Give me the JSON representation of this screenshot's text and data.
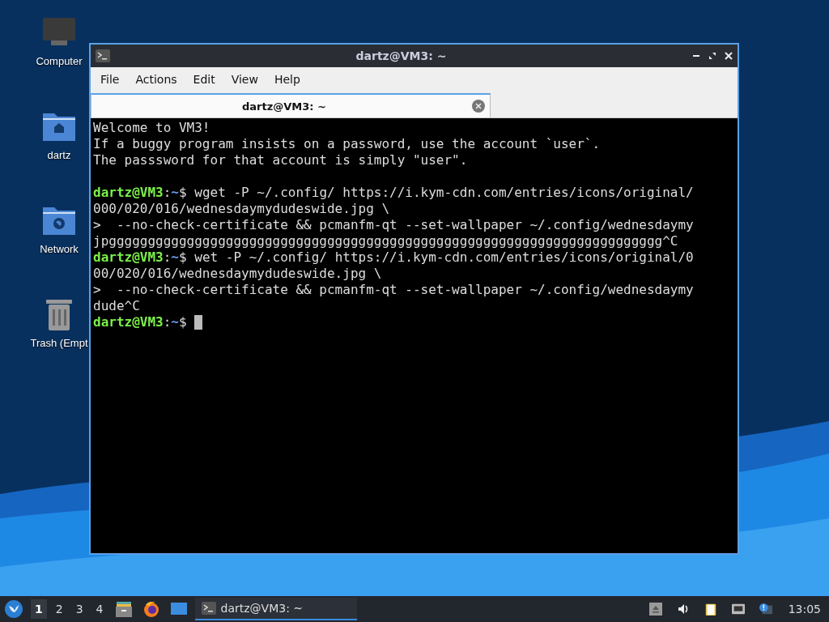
{
  "desktop_icons": [
    {
      "kind": "computer",
      "label": "Computer"
    },
    {
      "kind": "home",
      "label": "dartz"
    },
    {
      "kind": "network",
      "label": "Network"
    },
    {
      "kind": "trash",
      "label": "Trash (Empt"
    }
  ],
  "window": {
    "title": "dartz@VM3: ~",
    "menu": [
      "File",
      "Actions",
      "Edit",
      "View",
      "Help"
    ],
    "tabs": [
      {
        "label": "dartz@VM3: ~",
        "selected": true
      }
    ],
    "terminal": [
      {
        "kind": "text",
        "text": "Welcome to VM3!"
      },
      {
        "kind": "text",
        "text": "If a buggy program insists on a password, use the account `user`."
      },
      {
        "kind": "text",
        "text": "The passsword for that account is simply \"user\"."
      },
      {
        "kind": "blank"
      },
      {
        "kind": "prompt",
        "user": "dartz@VM3",
        "separator": ":",
        "path": "~",
        "command": "$ wget -P ~/.config/ https://i.kym-cdn.com/entries/icons/original/",
        "cursor": false
      },
      {
        "kind": "text",
        "text": "000/020/016/wednesdaymydudeswide.jpg \\"
      },
      {
        "kind": "text",
        "text": ">  --no-check-certificate && pcmanfm-qt --set-wallpaper ~/.config/wednesdaymy"
      },
      {
        "kind": "text",
        "text": "jpggggggggggggggggggggggggggggggggggggggggggggggggggggggggggggggggggggggg^C"
      },
      {
        "kind": "prompt",
        "user": "dartz@VM3",
        "separator": ":",
        "path": "~",
        "command": "$ wet -P ~/.config/ https://i.kym-cdn.com/entries/icons/original/0",
        "cursor": false
      },
      {
        "kind": "text",
        "text": "00/020/016/wednesdaymydudeswide.jpg \\"
      },
      {
        "kind": "text",
        "text": ">  --no-check-certificate && pcmanfm-qt --set-wallpaper ~/.config/wednesdaymy"
      },
      {
        "kind": "text",
        "text": "dude^C"
      },
      {
        "kind": "prompt",
        "user": "dartz@VM3",
        "separator": ":",
        "path": "~",
        "command": "$ ",
        "cursor": true
      }
    ]
  },
  "taskbar": {
    "workspaces": [
      {
        "label": "1",
        "selected": true
      },
      {
        "label": "2",
        "selected": false
      },
      {
        "label": "3",
        "selected": false
      },
      {
        "label": "4",
        "selected": false
      }
    ],
    "launchers": [
      {
        "kind": "file-manager"
      },
      {
        "kind": "browser"
      },
      {
        "kind": "desktop"
      }
    ],
    "tasks": [
      {
        "label": "dartz@VM3: ~",
        "selected": true
      }
    ],
    "clock": "13:05"
  }
}
